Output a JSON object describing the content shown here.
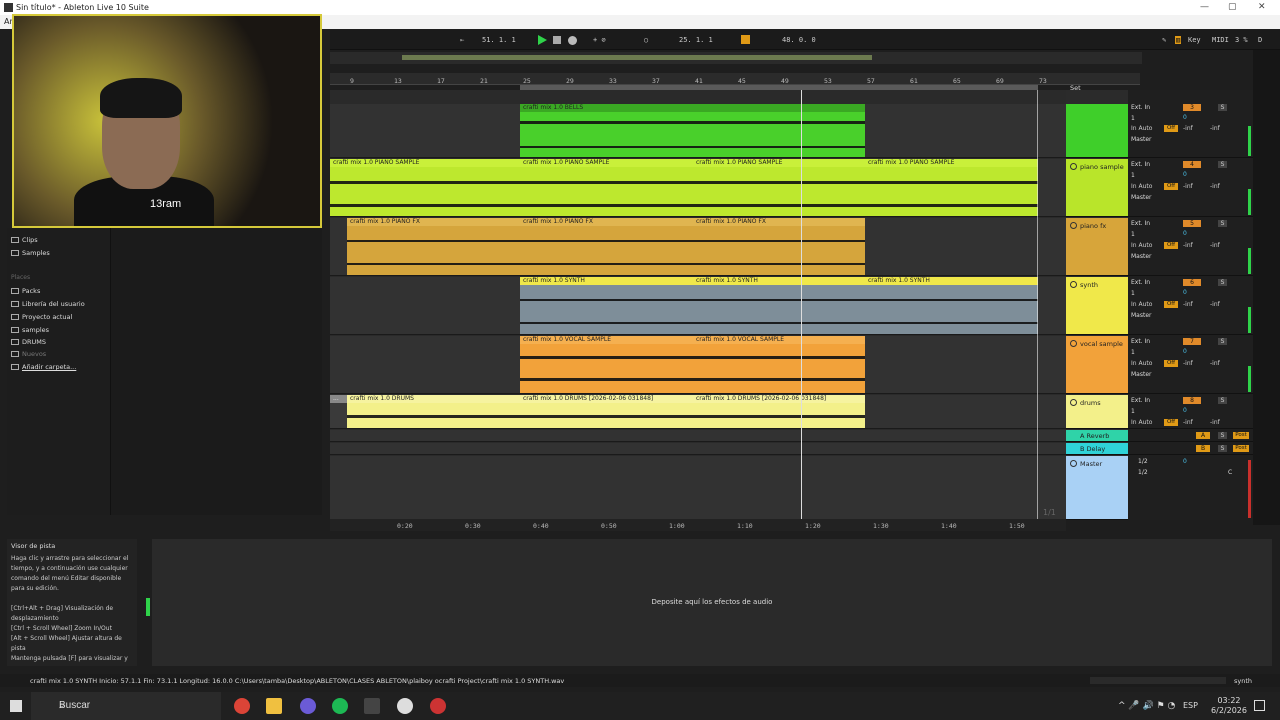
{
  "window": {
    "title": "Sin título* - Ableton Live 10 Suite",
    "menu_label": "Ar"
  },
  "transport": {
    "tempo": "",
    "position": "51.   1.   1",
    "loop_start": "25.   1.   1",
    "loop_length": "48.   0.   0",
    "key": "Key",
    "midi": "MIDI",
    "cpu": "3 %",
    "d": "D"
  },
  "ruler": {
    "bars": [
      "9",
      "13",
      "17",
      "21",
      "25",
      "29",
      "33",
      "37",
      "41",
      "45",
      "49",
      "53",
      "57",
      "61",
      "65",
      "69",
      "73"
    ],
    "set_label": "Set"
  },
  "time_ruler": [
    "0:20",
    "0:30",
    "0:40",
    "0:50",
    "1:00",
    "1:10",
    "1:20",
    "1:30",
    "1:40",
    "1:50"
  ],
  "loop_marker": "1/1",
  "clips": {
    "bells": "crafti mix 1.0 BELLS",
    "piano_sample": "crafti mix 1.0 PIANO SAMPLE",
    "piano_fx": "crafti mix 1.0 PIANO FX",
    "synth": "crafti mix 1.0 SYNTH",
    "vocal": "crafti mix 1.0 VOCAL SAMPLE",
    "drums": "crafti mix 1.0 DRUMS",
    "drums_rec": "crafti mix 1.0 DRUMS [2026-02-06 031848]",
    "truncated_start": "..."
  },
  "tracks": [
    {
      "name": "",
      "color": "#3fcf2a",
      "num": "3"
    },
    {
      "name": "piano sample",
      "color": "#b9e52a",
      "num": "4"
    },
    {
      "name": "piano fx",
      "color": "#d7a53a",
      "num": "5"
    },
    {
      "name": "synth",
      "color": "#f0e84a",
      "num": "6"
    },
    {
      "name": "vocal sample",
      "color": "#f2a23a",
      "num": "7"
    },
    {
      "name": "drums",
      "color": "#f3f08a",
      "num": "8"
    }
  ],
  "returns": [
    {
      "name": "A Reverb",
      "letter": "A",
      "color": "#2fd3a8"
    },
    {
      "name": "B Delay",
      "letter": "B",
      "color": "#2fd3d8"
    }
  ],
  "master": {
    "name": "Master",
    "cue": "1/2",
    "out": "1/2",
    "vol": "0",
    "color": "#a9d1f5"
  },
  "mixer": {
    "ext_in": "Ext. In",
    "in_ch": "1",
    "in_label": "In",
    "auto_label": "Auto",
    "off_label": "Off",
    "inf": "-inf",
    "master": "Master",
    "vol": "0",
    "pan": "C",
    "solo": "S",
    "post": "Post"
  },
  "browser": {
    "categories": [
      "Clips",
      "Samples"
    ],
    "places_header": "Places",
    "places": [
      "Packs",
      "Librería del usuario",
      "Proyecto actual",
      "samples",
      "DRUMS",
      "Nuevos",
      "Añadir carpeta..."
    ]
  },
  "webcam": {
    "caption": "13ram"
  },
  "info": {
    "title": "Visor de pista",
    "text": "Haga clic y arrastre para seleccionar el tiempo, y a continuación use cualquier comando del menú Editar disponible para su edición.\n\n[Ctrl+Alt + Drag] Visualización de desplazamiento\n[Ctrl + Scroll Wheel] Zoom In/Out\n[Alt + Scroll Wheel] Ajustar altura de pista\nMantenga pulsada [F] para visualizar y"
  },
  "device": {
    "drop_message": "Deposite aquí los efectos de audio"
  },
  "status": {
    "text": "crafti mix 1.0 SYNTH  Inicio: 57.1.1  Fin: 73.1.1  Longitud: 16.0.0  C:\\Users\\tamba\\Desktop\\ABLETON\\CLASES ABLETON\\plaiboy ocrafti Project\\crafti mix 1.0 SYNTH.wav",
    "track": "synth"
  },
  "taskbar": {
    "search": "Buscar",
    "lang": "ESP",
    "time": "03:22",
    "date": "6/2/2026"
  }
}
